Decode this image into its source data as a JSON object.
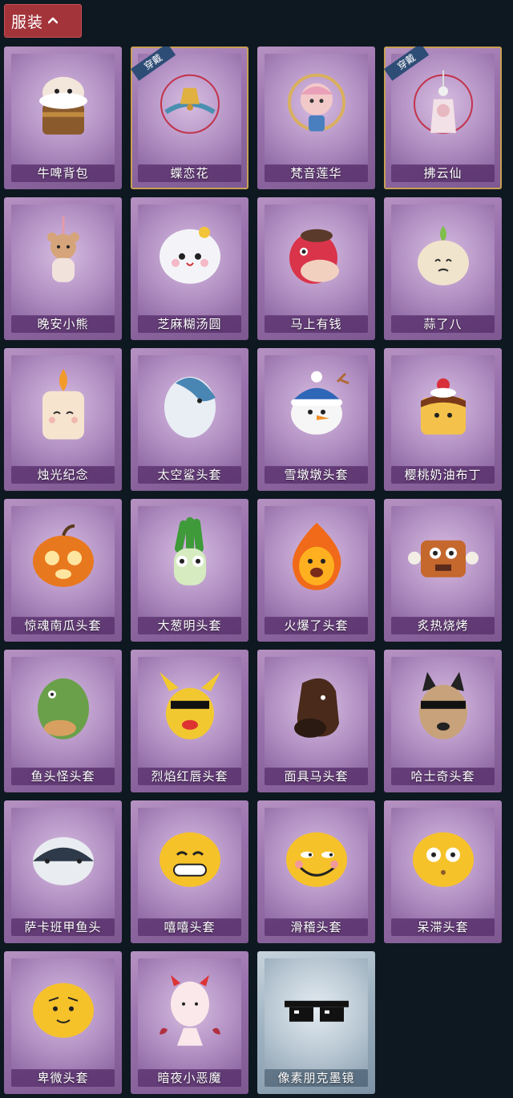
{
  "header": {
    "label": "服装"
  },
  "icons": {
    "collapse": "chevron-up-icon",
    "equipped_tag": "ribbon"
  },
  "colors": {
    "header_bg": "#a3343a",
    "card_purple": "#9a72ad",
    "card_clear": "#9eb2c1",
    "equipped_border": "#c7a054",
    "tag_blue": "#2e4d76"
  },
  "items": [
    {
      "name": "牛啤背包",
      "equipped": null,
      "art": "cow-backpack",
      "style": "purple"
    },
    {
      "name": "蝶恋花",
      "equipped": "穿戴",
      "art": "butterfly-bell",
      "style": "purple"
    },
    {
      "name": "梵音莲华",
      "equipped": null,
      "art": "lotus-girl",
      "style": "purple"
    },
    {
      "name": "拂云仙",
      "equipped": "穿戴",
      "art": "fairy-charm",
      "style": "purple"
    },
    {
      "name": "晚安小熊",
      "equipped": null,
      "art": "bear-charm",
      "style": "purple"
    },
    {
      "name": "芝麻糊汤圆",
      "equipped": null,
      "art": "dumpling",
      "style": "purple"
    },
    {
      "name": "马上有钱",
      "equipped": null,
      "art": "horse-head",
      "style": "purple"
    },
    {
      "name": "蒜了八",
      "equipped": null,
      "art": "garlic",
      "style": "purple"
    },
    {
      "name": "烛光纪念",
      "equipped": null,
      "art": "candle",
      "style": "purple"
    },
    {
      "name": "太空鲨头套",
      "equipped": null,
      "art": "shark-egg",
      "style": "purple"
    },
    {
      "name": "雪墩墩头套",
      "equipped": null,
      "art": "snowman",
      "style": "purple"
    },
    {
      "name": "樱桃奶油布丁",
      "equipped": null,
      "art": "pudding",
      "style": "purple"
    },
    {
      "name": "惊魂南瓜头套",
      "equipped": null,
      "art": "pumpkin",
      "style": "purple"
    },
    {
      "name": "大葱明头套",
      "equipped": null,
      "art": "scallion",
      "style": "purple"
    },
    {
      "name": "火爆了头套",
      "equipped": null,
      "art": "fire",
      "style": "purple"
    },
    {
      "name": "炙热烧烤",
      "equipped": null,
      "art": "bbq-meat",
      "style": "purple"
    },
    {
      "name": "鱼头怪头套",
      "equipped": null,
      "art": "fish-mask",
      "style": "purple"
    },
    {
      "name": "烈焰红唇头套",
      "equipped": null,
      "art": "pika-mask",
      "style": "purple"
    },
    {
      "name": "面具马头套",
      "equipped": null,
      "art": "horse-mask",
      "style": "purple"
    },
    {
      "name": "哈士奇头套",
      "equipped": null,
      "art": "husky-mask",
      "style": "purple"
    },
    {
      "name": "萨卡班甲鱼头",
      "equipped": null,
      "art": "fish-head",
      "style": "purple"
    },
    {
      "name": "嘻嘻头套",
      "equipped": null,
      "art": "grin-emoji",
      "style": "purple"
    },
    {
      "name": "滑稽头套",
      "equipped": null,
      "art": "funny-emoji",
      "style": "purple"
    },
    {
      "name": "呆滞头套",
      "equipped": null,
      "art": "dazed-emoji",
      "style": "purple"
    },
    {
      "name": "卑微头套",
      "equipped": null,
      "art": "humble-emoji",
      "style": "purple"
    },
    {
      "name": "暗夜小恶魔",
      "equipped": null,
      "art": "devil-girl",
      "style": "purple"
    },
    {
      "name": "像素朋克墨镜",
      "equipped": null,
      "art": "pixel-sunglasses",
      "style": "clear"
    }
  ]
}
